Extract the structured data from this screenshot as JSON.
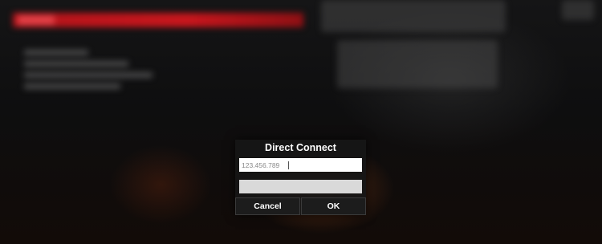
{
  "dialog": {
    "title": "Direct Connect",
    "host_field": {
      "value": "",
      "placeholder": "123.456.789"
    },
    "port_field": {
      "value": "",
      "placeholder": ""
    },
    "cancel_label": "Cancel",
    "ok_label": "OK"
  },
  "colors": {
    "accent_bar": "#c8161d",
    "dialog_bg": "#161616",
    "button_text": "#ffffff"
  }
}
